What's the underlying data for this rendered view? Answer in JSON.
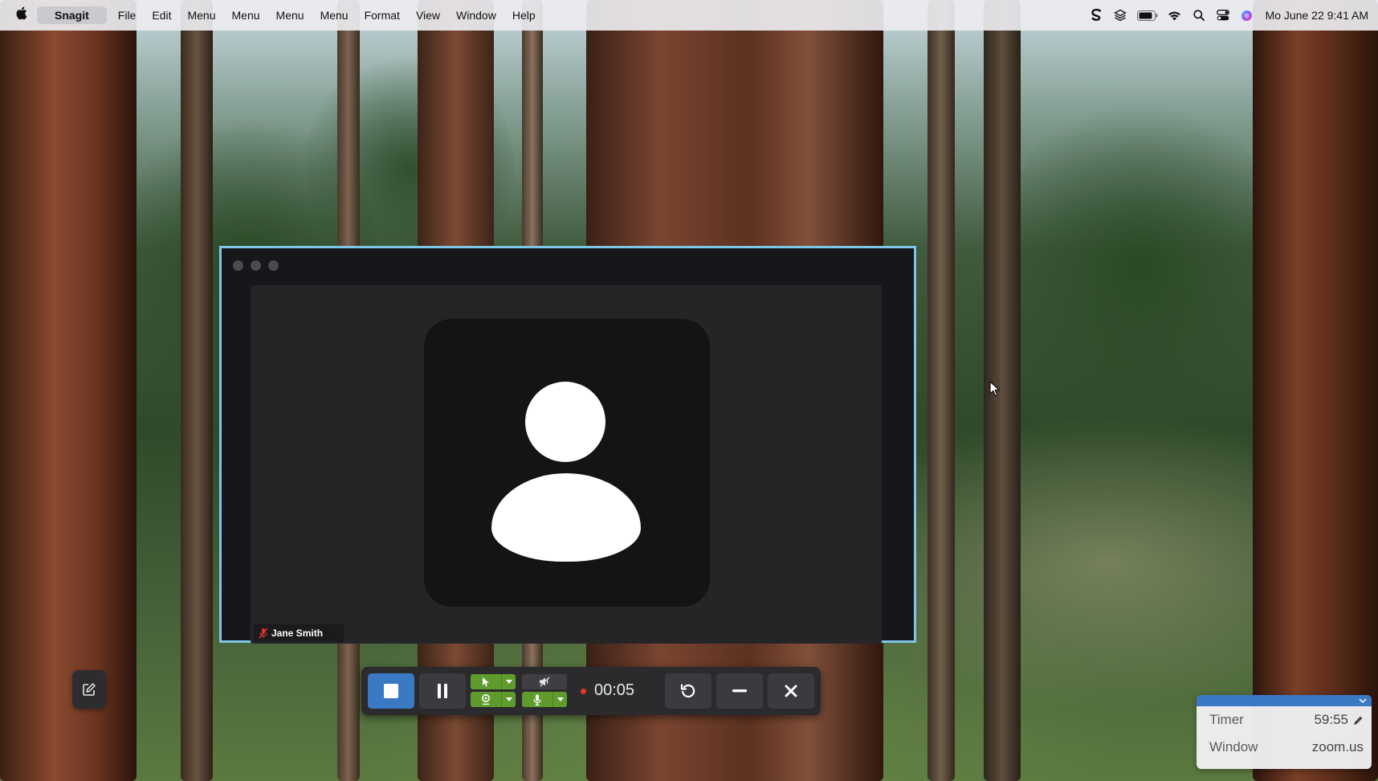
{
  "menubar": {
    "app_name": "Snagit",
    "items": [
      "File",
      "Edit",
      "Menu",
      "Menu",
      "Menu",
      "Menu",
      "Format",
      "View",
      "Window",
      "Help"
    ],
    "clock": "Mo June 22  9:41 AM",
    "status_icons": [
      "snagit-icon",
      "layers-icon",
      "battery-icon",
      "wifi-icon",
      "search-icon",
      "control-center-icon",
      "siri-icon"
    ]
  },
  "zoom_window": {
    "participant_name": "Jane Smith"
  },
  "recording_toolbar": {
    "elapsed": "00:05",
    "accent_color": "#3a79c4",
    "active_color": "#5f9b2d"
  },
  "timer_widget": {
    "timer_label": "Timer",
    "timer_value": "59:55",
    "window_label": "Window",
    "window_value": "zoom.us"
  }
}
